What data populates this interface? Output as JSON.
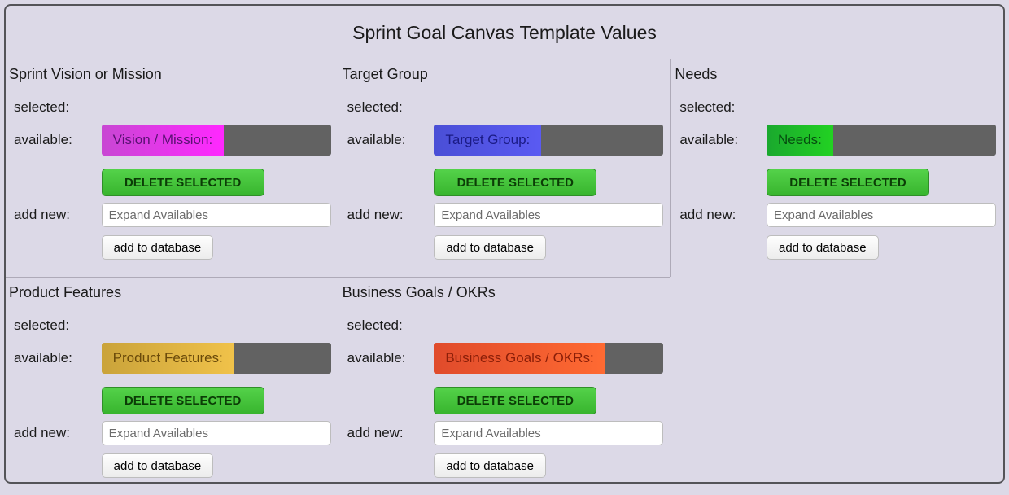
{
  "title": "Sprint Goal Canvas Template Values",
  "labels": {
    "selected": "selected:",
    "available": "available:",
    "deleteSelected": "DELETE SELECTED",
    "addNew": "add new:",
    "addToDatabase": "add to database",
    "placeholder": "Expand Availables"
  },
  "panels": [
    {
      "id": "vision",
      "heading": "Sprint Vision or Mission",
      "chip": "Vision / Mission:",
      "grad": "g-magenta"
    },
    {
      "id": "target",
      "heading": "Target Group",
      "chip": "Target Group:",
      "grad": "g-blue"
    },
    {
      "id": "needs",
      "heading": "Needs",
      "chip": "Needs:",
      "grad": "g-green"
    },
    {
      "id": "features",
      "heading": "Product Features",
      "chip": "Product Features:",
      "grad": "g-gold"
    },
    {
      "id": "goals",
      "heading": "Business Goals / OKRs",
      "chip": "Business Goals / OKRs:",
      "grad": "g-orange"
    }
  ]
}
